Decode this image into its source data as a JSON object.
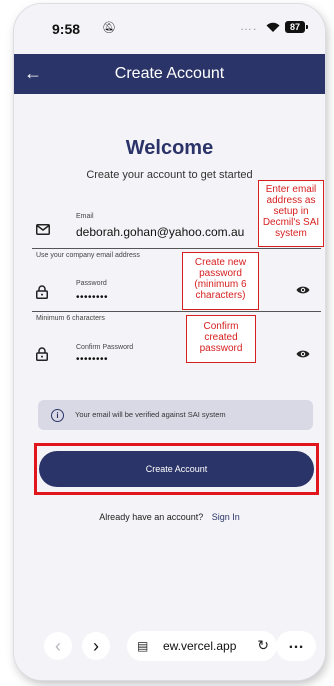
{
  "status": {
    "time": "9:58",
    "battery": "87"
  },
  "appbar": {
    "title": "Create Account"
  },
  "welcome": {
    "title": "Welcome",
    "subtitle": "Create your account to get started"
  },
  "form": {
    "email": {
      "label": "Email",
      "value": "deborah.gohan@yahoo.com.au",
      "helper": "Use your company email address"
    },
    "password": {
      "label": "Password",
      "value": "••••••••",
      "helper": "Minimum 6 characters"
    },
    "confirm": {
      "label": "Confirm Password",
      "value": "••••••••"
    }
  },
  "callouts": {
    "email": "Enter email address as setup in Decmil's SAI system",
    "password": "Create new password (minimum 6 characters)",
    "confirm": "Confirm created password"
  },
  "info": {
    "text": "Your email will be verified against SAI system"
  },
  "button": {
    "label": "Create Account"
  },
  "signin": {
    "prompt": "Already have an account?",
    "link": "Sign In"
  },
  "browser": {
    "url": "ew.vercel.app"
  },
  "colors": {
    "primary": "#2b3468",
    "annotation": "#e0161c"
  }
}
